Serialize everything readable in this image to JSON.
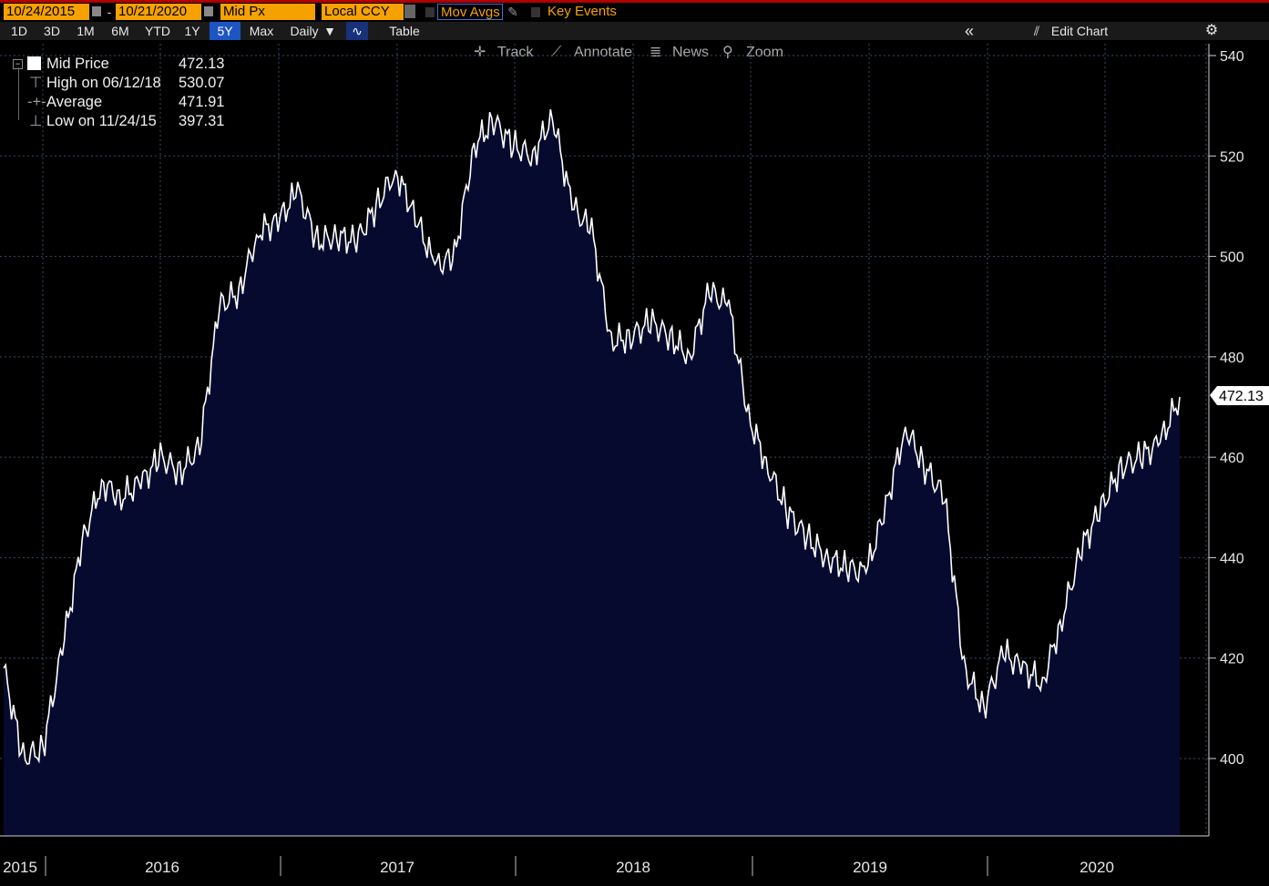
{
  "toolbar": {
    "start_date": "10/24/2015",
    "date_sep": "-",
    "end_date": "10/21/2020",
    "field": "Mid Px",
    "currency": "Local CCY",
    "mov_avgs": "Mov Avgs",
    "key_events": "Key Events",
    "ranges": [
      "1D",
      "3D",
      "1M",
      "6M",
      "YTD",
      "1Y",
      "5Y",
      "Max"
    ],
    "selected_range": "5Y",
    "period": "Daily",
    "table": "Table",
    "collapse": "«",
    "edit_chart": "Edit Chart",
    "settings_icon": "gear-icon"
  },
  "tools": {
    "track": "Track",
    "annotate": "Annotate",
    "news": "News",
    "zoom": "Zoom"
  },
  "legend": {
    "mid_label": "Mid Price",
    "mid_value": "472.13",
    "high_label": "High on 06/12/18",
    "high_value": "530.07",
    "avg_label": "Average",
    "avg_value": "471.91",
    "low_label": "Low on 11/24/15",
    "low_value": "397.31"
  },
  "last_price_tag": "472.13",
  "colors": {
    "background": "#000000",
    "area_fill": "#050a2e",
    "line": "#ffffff",
    "accent_orange": "#f5a200",
    "selected_blue": "#1d55c4"
  },
  "chart_data": {
    "type": "area",
    "series": [
      {
        "name": "Mid Price",
        "values": []
      }
    ],
    "x": [
      "2015-10",
      "2015-11",
      "2015-12",
      "2016-01",
      "2016-02",
      "2016-03",
      "2016-04",
      "2016-05",
      "2016-06",
      "2016-07",
      "2016-08",
      "2016-09",
      "2016-10",
      "2016-11",
      "2016-12",
      "2017-01",
      "2017-02",
      "2017-03",
      "2017-04",
      "2017-05",
      "2017-06",
      "2017-07",
      "2017-08",
      "2017-09",
      "2017-10",
      "2017-11",
      "2017-12",
      "2018-01",
      "2018-02",
      "2018-03",
      "2018-04",
      "2018-05",
      "2018-06",
      "2018-07",
      "2018-08",
      "2018-09",
      "2018-10",
      "2018-11",
      "2018-12",
      "2019-01",
      "2019-02",
      "2019-03",
      "2019-04",
      "2019-05",
      "2019-06",
      "2019-07",
      "2019-08",
      "2019-09",
      "2019-10",
      "2019-11",
      "2019-12",
      "2020-01",
      "2020-02",
      "2020-03",
      "2020-04",
      "2020-05",
      "2020-06",
      "2020-07",
      "2020-08",
      "2020-09",
      "2020-10"
    ],
    "y": [
      418,
      400,
      402,
      422,
      443,
      455,
      452,
      455,
      460,
      457,
      462,
      490,
      493,
      505,
      507,
      513,
      503,
      504,
      503,
      510,
      517,
      508,
      498,
      500,
      522,
      527,
      522,
      520,
      528,
      510,
      505,
      483,
      484,
      487,
      484,
      480,
      493,
      490,
      468,
      458,
      449,
      444,
      440,
      438,
      437,
      450,
      466,
      458,
      452,
      418,
      410,
      421,
      418,
      415,
      428,
      442,
      450,
      458,
      460,
      463,
      472
    ],
    "yticks": [
      "400",
      "420",
      "440",
      "460",
      "480",
      "500",
      "520",
      "540"
    ],
    "ylim": [
      385,
      543
    ],
    "xtick_labels": [
      "2015",
      "2016",
      "2017",
      "2018",
      "2019",
      "2020"
    ],
    "title": "",
    "xlabel": "",
    "ylabel": "",
    "grid": true,
    "legend_position": "top-left"
  }
}
